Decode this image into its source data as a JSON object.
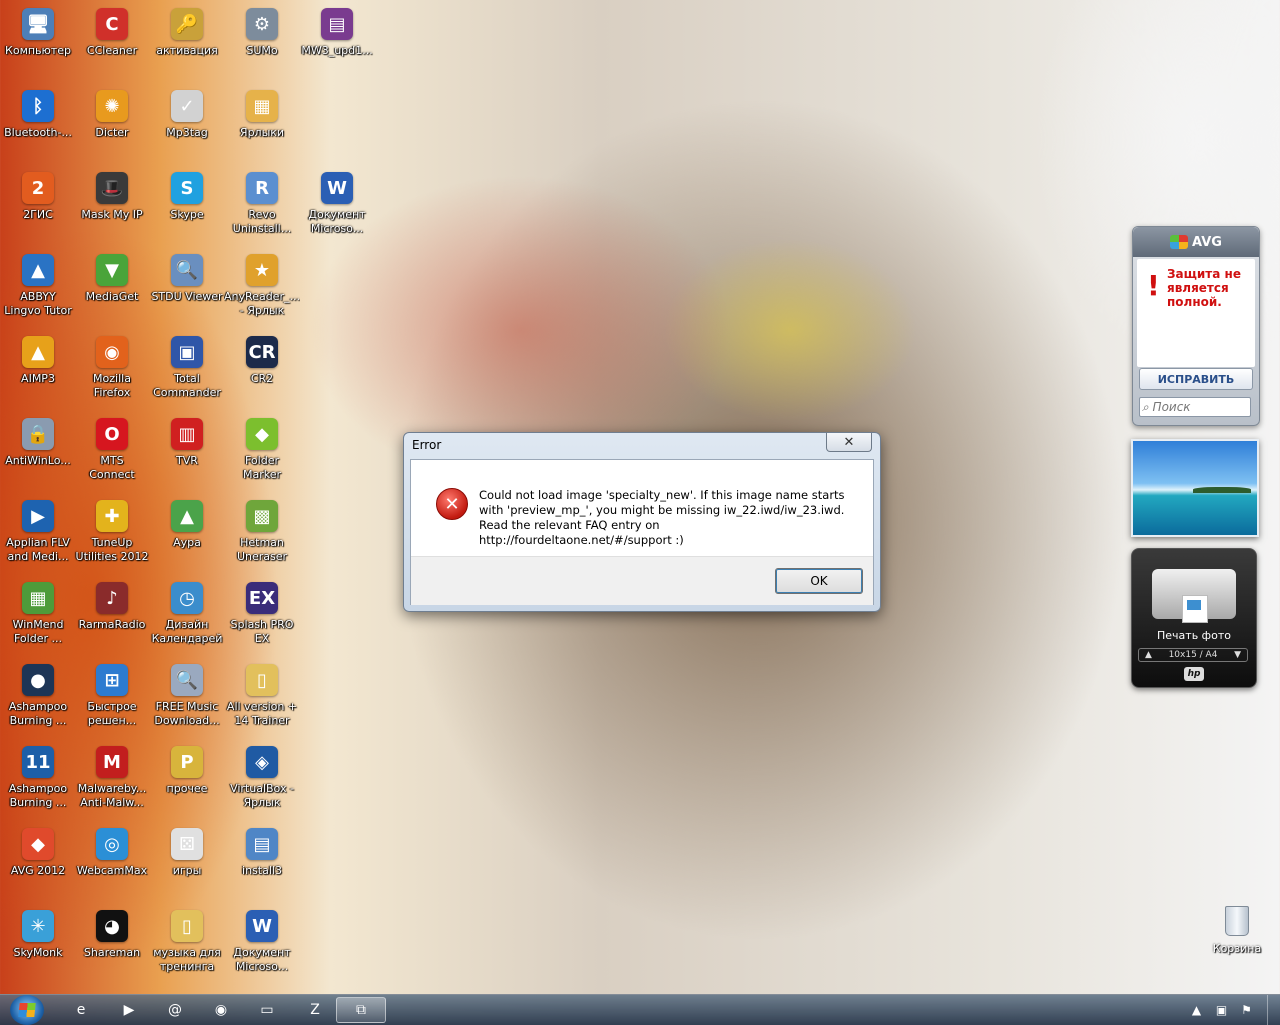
{
  "desktop_icons": [
    {
      "label": "Компьютер",
      "glyph": "🖥",
      "color": "#4d7fb8"
    },
    {
      "label": "CCleaner",
      "glyph": "C",
      "color": "#d0302a"
    },
    {
      "label": "активация",
      "glyph": "🔑",
      "color": "#c9a13a"
    },
    {
      "label": "SUMo",
      "glyph": "⚙",
      "color": "#7d8c9c"
    },
    {
      "label": "MW3_upd1...",
      "glyph": "▤",
      "color": "#7a3b8f"
    },
    {
      "label": "Bluetooth-...",
      "glyph": "ᛒ",
      "color": "#1d6fd1"
    },
    {
      "label": "Dicter",
      "glyph": "✺",
      "color": "#e89a1e"
    },
    {
      "label": "Mp3tag",
      "glyph": "✓",
      "color": "#d2d2d2"
    },
    {
      "label": "Ярлыки",
      "glyph": "▦",
      "color": "#e6b24a"
    },
    {
      "label": "2ГИС",
      "glyph": "2",
      "color": "#e25c1f"
    },
    {
      "label": "Mask My IP",
      "glyph": "🎩",
      "color": "#3a3a3a"
    },
    {
      "label": "Skype",
      "glyph": "S",
      "color": "#20a1e0"
    },
    {
      "label": "Revo\nUninstall...",
      "glyph": "R",
      "color": "#5b8fd0"
    },
    {
      "label": "Документ\nMicroso...",
      "glyph": "W",
      "color": "#2b5fb4"
    },
    {
      "label": "ABBYY\nLingvo Tutor",
      "glyph": "▲",
      "color": "#2a73c4"
    },
    {
      "label": "MediaGet",
      "glyph": "▼",
      "color": "#4aa43a"
    },
    {
      "label": "STDU Viewer",
      "glyph": "🔍",
      "color": "#6a8fbf"
    },
    {
      "label": "AnyReader_...\n- Ярлык",
      "glyph": "★",
      "color": "#e0a12c"
    },
    {
      "label": "AIMP3",
      "glyph": "▲",
      "color": "#e7a11a"
    },
    {
      "label": "Mozilla\nFirefox",
      "glyph": "◉",
      "color": "#e2621c"
    },
    {
      "label": "Total\nCommander",
      "glyph": "▣",
      "color": "#2f56a8"
    },
    {
      "label": "CR2",
      "glyph": "CR",
      "color": "#1c2a4a"
    },
    {
      "label": "AntiWinLo...",
      "glyph": "🔒",
      "color": "#8a9bb0"
    },
    {
      "label": "MTS\nConnect",
      "glyph": "O",
      "color": "#d6161f"
    },
    {
      "label": "TVR",
      "glyph": "▥",
      "color": "#d02020"
    },
    {
      "label": "Folder\nMarker",
      "glyph": "◆",
      "color": "#7cbf2e"
    },
    {
      "label": "Applian FLV\nand Medi...",
      "glyph": "▶",
      "color": "#1e63b0"
    },
    {
      "label": "TuneUp\nUtilities 2012",
      "glyph": "✚",
      "color": "#e3b31c"
    },
    {
      "label": "Аура",
      "glyph": "▲",
      "color": "#4ba34a"
    },
    {
      "label": "Hetman\nUneraser",
      "glyph": "▩",
      "color": "#6fa63b"
    },
    {
      "label": "WinMend\nFolder ...",
      "glyph": "▦",
      "color": "#4e9b3a"
    },
    {
      "label": "RarmaRadio",
      "glyph": "♪",
      "color": "#8a2b2b"
    },
    {
      "label": "Дизайн\nКалендарей",
      "glyph": "◷",
      "color": "#3b8dcc"
    },
    {
      "label": "Splash PRO\nEX",
      "glyph": "EX",
      "color": "#3a2c7a"
    },
    {
      "label": "Ashampoo\nBurning ...",
      "glyph": "●",
      "color": "#1d3556"
    },
    {
      "label": "Быстрое\nрешен...",
      "glyph": "⊞",
      "color": "#2d7bd0"
    },
    {
      "label": "FREE Music\nDownload...",
      "glyph": "🔍",
      "color": "#9aa9bf"
    },
    {
      "label": "All version +\n14 Trainer",
      "glyph": "▯",
      "color": "#e2c05c"
    },
    {
      "label": "Ashampoo\nBurning ...",
      "glyph": "11",
      "color": "#1d5fa8"
    },
    {
      "label": "Malwareby...\nAnti-Malw...",
      "glyph": "M",
      "color": "#c21e1e"
    },
    {
      "label": "прочее",
      "glyph": "P",
      "color": "#d8b43c"
    },
    {
      "label": "VirtualBox -\nЯрлык",
      "glyph": "◈",
      "color": "#1f5aa3"
    },
    {
      "label": "AVG 2012",
      "glyph": "◆",
      "color": "#e04a2c"
    },
    {
      "label": "WebcamMax",
      "glyph": "◎",
      "color": "#2b8fd6"
    },
    {
      "label": "игры",
      "glyph": "⚄",
      "color": "#e0e0e0"
    },
    {
      "label": "install3",
      "glyph": "▤",
      "color": "#4f86c6"
    },
    {
      "label": "SkyMonk",
      "glyph": "✳",
      "color": "#3aa0d8"
    },
    {
      "label": "Shareman",
      "glyph": "◕",
      "color": "#111111"
    },
    {
      "label": "музыка для\nтренинга",
      "glyph": "▯",
      "color": "#e2c05c"
    },
    {
      "label": "Документ\nMicroso...",
      "glyph": "W",
      "color": "#2b5fb4"
    }
  ],
  "dialog": {
    "title": "Error",
    "close_glyph": "✕",
    "message": "Could not load image 'specialty_new'. If this image name starts with 'preview_mp_', you might be missing iw_22.iwd/iw_23.iwd. Read the relevant FAQ entry on http://fourdeltaone.net/#/support :)",
    "ok_label": "OK"
  },
  "avg_gadget": {
    "brand": "AVG",
    "warning_mark": "!",
    "warning": "Защита не является полной.",
    "fix_label": "ИСПРАВИТЬ",
    "search_placeholder": "Поиск"
  },
  "print_gadget": {
    "label": "Печать фото",
    "size": "10x15 / A4",
    "up_glyph": "▲",
    "down_glyph": "▼",
    "brand": "hp"
  },
  "recycle_bin": {
    "label": "Корзина"
  },
  "taskbar": {
    "buttons": [
      {
        "name": "ie",
        "glyph": "e"
      },
      {
        "name": "media-player",
        "glyph": "▶"
      },
      {
        "name": "icq",
        "glyph": "@"
      },
      {
        "name": "firefox",
        "glyph": "◉"
      },
      {
        "name": "explorer",
        "glyph": "▭"
      },
      {
        "name": "game",
        "glyph": "Z"
      },
      {
        "name": "error-window",
        "glyph": "⧉"
      }
    ],
    "tray": {
      "arrow": "▲",
      "net": "▣",
      "flag": "⚑"
    }
  }
}
